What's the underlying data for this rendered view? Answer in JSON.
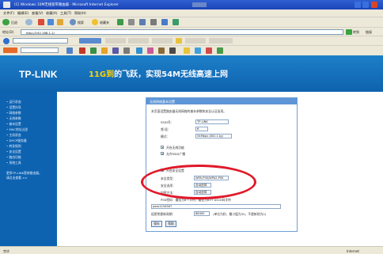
{
  "window": {
    "title": "(C) Windows 10M无线宽带路由器 - Microsoft Internet Explorer",
    "colors": {
      "titlebar": "#1a45b8",
      "header": "#1d7fc9",
      "sidebar": "#0e63b1",
      "highlight": "#e0192a"
    }
  },
  "menu": [
    "文件(F)",
    "编辑(E)",
    "查看(V)",
    "收藏(A)",
    "工具(T)",
    "帮助(H)"
  ],
  "toolbar": {
    "back_label": "后退",
    "search_label": "搜索",
    "favorites_label": "收藏夹"
  },
  "address": {
    "label": "地址(D)",
    "value": "http://192.168.1.1/",
    "go_label": "转到",
    "links_label": "链接"
  },
  "brand": {
    "logo": "TP-LINK",
    "slogan_prefix": "11G到",
    "slogan_hl": "54M",
    "slogan_suffix": "的飞跃，实现54M无线高速上网"
  },
  "sidebar": {
    "items": [
      "• 运行状态",
      "• 设置向导",
      "• 网络参数",
      "• 无线参数",
      "  • 基本设置",
      "  • MAC地址过滤",
      "  • 主机状态",
      "• DHCP服务器",
      "• 转发规则",
      "• 安全设置",
      "• 路由功能",
      "• 系统工具",
      "更多TP-LINK宽带路由器，",
      "请点击查看 >>"
    ]
  },
  "panel": {
    "title": "无线网络基本设置",
    "intro": "本页面设置路由器无线网络的基本参数和安全认证选项。",
    "ssid_label": "SSID号：",
    "ssid_value": "TP-LINK",
    "channel_label": "频 段：",
    "channel_value": "6",
    "mode_label": "模式：",
    "mode_value": "54Mbps (802.11g)",
    "enable_wireless": "开启无线功能",
    "enable_ssid_broadcast": "允许SSID广播",
    "enable_security": "开启安全设置",
    "security_type_label": "安全类型：",
    "security_type_value": "WPA-PSK/WPA2-PSK",
    "security_option_label": "安全选项：",
    "security_option_value": "自动选择",
    "encryption_label": "加密方法：",
    "encryption_value": "自动选择",
    "psk_hint": "PSK密码：最短为8个字符，最长为63个ASCII码字符",
    "psk_value": "pass1234567",
    "group_key_label": "组密钥更新周期：",
    "group_key_value": "86400",
    "group_key_hint": "(单位为秒，最小值为30，不更新则为0)",
    "save_label": "保存",
    "help_label": "帮助"
  },
  "status": {
    "left": "完毕",
    "right": "Internet"
  }
}
